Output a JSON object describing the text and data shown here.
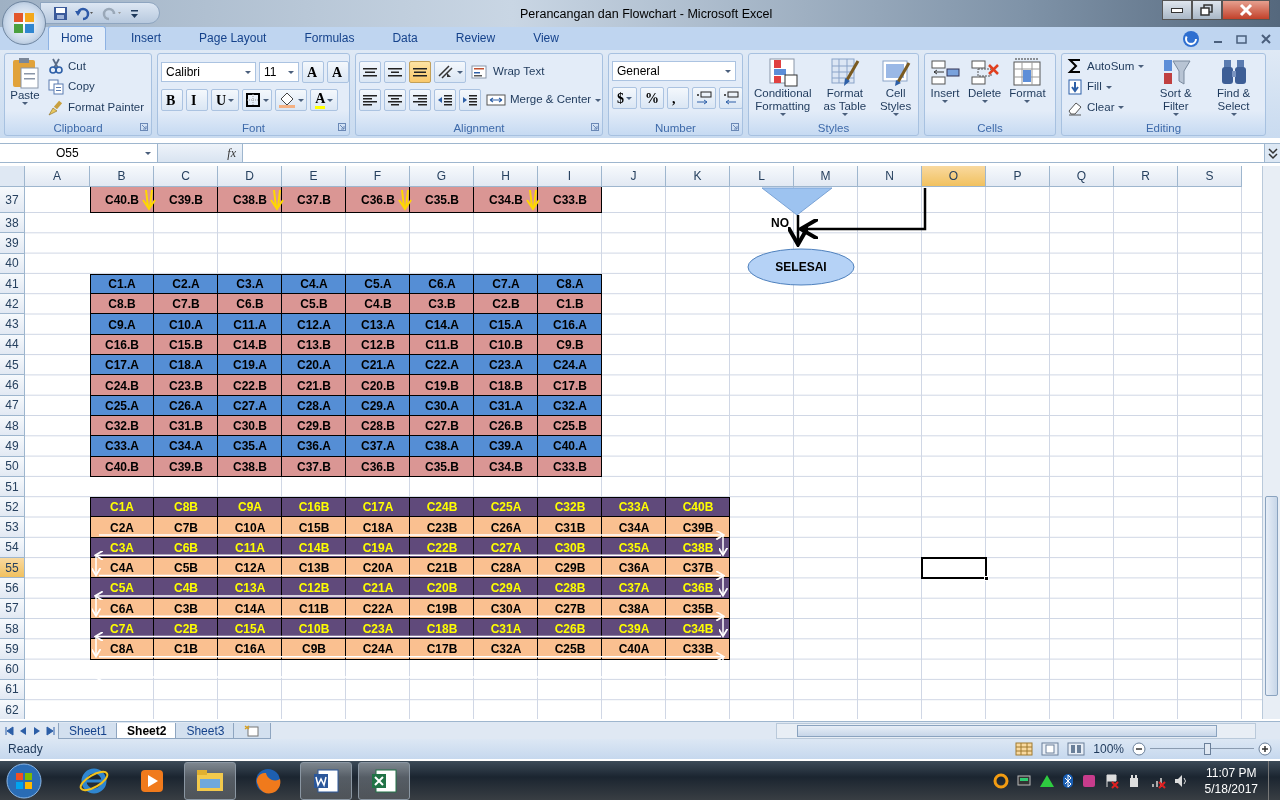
{
  "window": {
    "title": "Perancangan dan Flowchart - Microsoft Excel"
  },
  "tabs": [
    {
      "label": "Home",
      "selected": true
    },
    {
      "label": "Insert",
      "selected": false
    },
    {
      "label": "Page Layout",
      "selected": false
    },
    {
      "label": "Formulas",
      "selected": false
    },
    {
      "label": "Data",
      "selected": false
    },
    {
      "label": "Review",
      "selected": false
    },
    {
      "label": "View",
      "selected": false
    }
  ],
  "ribbon": [
    {
      "label": "Clipboard",
      "launcher": true,
      "parts": [
        [
          {
            "kind": "big",
            "label": "Paste",
            "caret": true
          }
        ],
        [
          {
            "kind": "small",
            "label": "Cut",
            "caret": false
          },
          {
            "kind": "small",
            "label": "Copy",
            "caret": false
          },
          {
            "kind": "small",
            "label": "Format Painter",
            "caret": false
          }
        ]
      ]
    },
    {
      "label": "Font",
      "launcher": true,
      "parts": [
        [
          {
            "kind": "field",
            "value": "Calibri"
          },
          {
            "kind": "field",
            "value": "11"
          },
          {
            "kind": "glyph",
            "text": "A",
            "caret": false
          },
          {
            "kind": "glyph",
            "text": "A",
            "caret": false
          }
        ],
        [
          {
            "kind": "glyph",
            "text": "B",
            "caret": false
          },
          {
            "kind": "glyph",
            "text": "I",
            "caret": false
          },
          {
            "kind": "glyph",
            "text": "U",
            "caret": true
          },
          {
            "kind": "icon",
            "caret": true
          },
          {
            "kind": "icon",
            "caret": true
          },
          {
            "kind": "glyph",
            "text": "A",
            "caret": true
          }
        ]
      ]
    },
    {
      "label": "Alignment",
      "launcher": true,
      "parts": [
        [
          {
            "kind": "icon",
            "caret": false,
            "selected": false
          },
          {
            "kind": "icon",
            "caret": false,
            "selected": false
          },
          {
            "kind": "icon",
            "caret": false,
            "selected": true
          },
          {
            "kind": "icon",
            "caret": true
          },
          {
            "kind": "small",
            "label": "Wrap Text",
            "caret": false
          }
        ],
        [
          {
            "kind": "icon",
            "caret": false
          },
          {
            "kind": "icon",
            "caret": false
          },
          {
            "kind": "icon",
            "caret": false
          },
          {
            "kind": "icon",
            "caret": false
          },
          {
            "kind": "icon",
            "caret": false
          },
          {
            "kind": "small",
            "label": "Merge & Center",
            "caret": true
          }
        ]
      ]
    },
    {
      "label": "Number",
      "launcher": true,
      "parts": [
        [
          {
            "kind": "field",
            "value": "General"
          }
        ],
        [
          {
            "kind": "glyph",
            "text": "$",
            "caret": true
          },
          {
            "kind": "glyph",
            "text": "%",
            "caret": false
          },
          {
            "kind": "glyph",
            "text": ",",
            "caret": false
          },
          {
            "kind": "icon",
            "caret": false
          },
          {
            "kind": "icon",
            "caret": false
          }
        ]
      ]
    },
    {
      "label": "Styles",
      "launcher": false,
      "parts": [
        [
          {
            "kind": "big",
            "label": "Conditional Formatting",
            "caret": true
          }
        ],
        [
          {
            "kind": "big",
            "label": "Format as Table",
            "caret": true
          }
        ],
        [
          {
            "kind": "big",
            "label": "Cell Styles",
            "caret": true
          }
        ]
      ]
    },
    {
      "label": "Cells",
      "launcher": false,
      "parts": [
        [
          {
            "kind": "big",
            "label": "Insert",
            "caret": true
          }
        ],
        [
          {
            "kind": "big",
            "label": "Delete",
            "caret": true
          }
        ],
        [
          {
            "kind": "big",
            "label": "Format",
            "caret": true
          }
        ]
      ]
    },
    {
      "label": "Editing",
      "launcher": false,
      "parts": [
        [
          {
            "kind": "small",
            "label": "AutoSum",
            "caret": true
          },
          {
            "kind": "small",
            "label": "Fill",
            "caret": true
          },
          {
            "kind": "small",
            "label": "Clear",
            "caret": true
          }
        ],
        [
          {
            "kind": "big",
            "label": "Sort & Filter",
            "caret": true
          }
        ],
        [
          {
            "kind": "big",
            "label": "Find & Select",
            "caret": true
          }
        ]
      ]
    }
  ],
  "formula_bar": {
    "name_box": "O55",
    "fx": "fx"
  },
  "columns": [
    {
      "label": "A",
      "selected": false
    },
    {
      "label": "B",
      "selected": false
    },
    {
      "label": "C",
      "selected": false
    },
    {
      "label": "D",
      "selected": false
    },
    {
      "label": "E",
      "selected": false
    },
    {
      "label": "F",
      "selected": false
    },
    {
      "label": "G",
      "selected": false
    },
    {
      "label": "H",
      "selected": false
    },
    {
      "label": "I",
      "selected": false
    },
    {
      "label": "J",
      "selected": false
    },
    {
      "label": "K",
      "selected": false
    },
    {
      "label": "L",
      "selected": false
    },
    {
      "label": "M",
      "selected": false
    },
    {
      "label": "N",
      "selected": false
    },
    {
      "label": "O",
      "selected": true
    },
    {
      "label": "P",
      "selected": false
    },
    {
      "label": "Q",
      "selected": false
    },
    {
      "label": "R",
      "selected": false
    },
    {
      "label": "S",
      "selected": false
    }
  ],
  "rows": [
    {
      "number": "37",
      "selected": false,
      "kind": "pink",
      "cells": [
        "C40.B",
        "C39.B",
        "C38.B",
        "C37.B",
        "C36.B",
        "C35.B",
        "C34.B",
        "C33.B"
      ]
    },
    {
      "number": "38",
      "selected": false
    },
    {
      "number": "39",
      "selected": false
    },
    {
      "number": "40",
      "selected": false
    },
    {
      "number": "41",
      "selected": false,
      "kind": "blue",
      "cells": [
        "C1.A",
        "C2.A",
        "C3.A",
        "C4.A",
        "C5.A",
        "C6.A",
        "C7.A",
        "C8.A"
      ]
    },
    {
      "number": "42",
      "selected": false,
      "kind": "pink",
      "cells": [
        "C8.B",
        "C7.B",
        "C6.B",
        "C5.B",
        "C4.B",
        "C3.B",
        "C2.B",
        "C1.B"
      ]
    },
    {
      "number": "43",
      "selected": false,
      "kind": "blue",
      "cells": [
        "C9.A",
        "C10.A",
        "C11.A",
        "C12.A",
        "C13.A",
        "C14.A",
        "C15.A",
        "C16.A"
      ]
    },
    {
      "number": "44",
      "selected": false,
      "kind": "pink",
      "cells": [
        "C16.B",
        "C15.B",
        "C14.B",
        "C13.B",
        "C12.B",
        "C11.B",
        "C10.B",
        "C9.B"
      ]
    },
    {
      "number": "45",
      "selected": false,
      "kind": "blue",
      "cells": [
        "C17.A",
        "C18.A",
        "C19.A",
        "C20.A",
        "C21.A",
        "C22.A",
        "C23.A",
        "C24.A"
      ]
    },
    {
      "number": "46",
      "selected": false,
      "kind": "pink",
      "cells": [
        "C24.B",
        "C23.B",
        "C22.B",
        "C21.B",
        "C20.B",
        "C19.B",
        "C18.B",
        "C17.B"
      ]
    },
    {
      "number": "47",
      "selected": false,
      "kind": "blue",
      "cells": [
        "C25.A",
        "C26.A",
        "C27.A",
        "C28.A",
        "C29.A",
        "C30.A",
        "C31.A",
        "C32.A"
      ]
    },
    {
      "number": "48",
      "selected": false,
      "kind": "pink",
      "cells": [
        "C32.B",
        "C31.B",
        "C30.B",
        "C29.B",
        "C28.B",
        "C27.B",
        "C26.B",
        "C25.B"
      ]
    },
    {
      "number": "49",
      "selected": false,
      "kind": "blue",
      "cells": [
        "C33.A",
        "C34.A",
        "C35.A",
        "C36.A",
        "C37.A",
        "C38.A",
        "C39.A",
        "C40.A"
      ]
    },
    {
      "number": "50",
      "selected": false,
      "kind": "pink",
      "cells": [
        "C40.B",
        "C39.B",
        "C38.B",
        "C37.B",
        "C36.B",
        "C35.B",
        "C34.B",
        "C33.B"
      ]
    },
    {
      "number": "51",
      "selected": false
    },
    {
      "number": "52",
      "selected": false,
      "kind": "purple",
      "cells": [
        "C1A",
        "C8B",
        "C9A",
        "C16B",
        "C17A",
        "C24B",
        "C25A",
        "C32B",
        "C33A",
        "C40B"
      ]
    },
    {
      "number": "53",
      "selected": false,
      "kind": "peach",
      "cells": [
        "C2A",
        "C7B",
        "C10A",
        "C15B",
        "C18A",
        "C23B",
        "C26A",
        "C31B",
        "C34A",
        "C39B"
      ]
    },
    {
      "number": "54",
      "selected": false,
      "kind": "purple",
      "cells": [
        "C3A",
        "C6B",
        "C11A",
        "C14B",
        "C19A",
        "C22B",
        "C27A",
        "C30B",
        "C35A",
        "C38B"
      ]
    },
    {
      "number": "55",
      "selected": true,
      "kind": "peach",
      "cells": [
        "C4A",
        "C5B",
        "C12A",
        "C13B",
        "C20A",
        "C21B",
        "C28A",
        "C29B",
        "C36A",
        "C37B"
      ]
    },
    {
      "number": "56",
      "selected": false,
      "kind": "purple",
      "cells": [
        "C5A",
        "C4B",
        "C13A",
        "C12B",
        "C21A",
        "C20B",
        "C29A",
        "C28B",
        "C37A",
        "C36B"
      ]
    },
    {
      "number": "57",
      "selected": false,
      "kind": "peach",
      "cells": [
        "C6A",
        "C3B",
        "C14A",
        "C11B",
        "C22A",
        "C19B",
        "C30A",
        "C27B",
        "C38A",
        "C35B"
      ]
    },
    {
      "number": "58",
      "selected": false,
      "kind": "purple",
      "cells": [
        "C7A",
        "C2B",
        "C15A",
        "C10B",
        "C23A",
        "C18B",
        "C31A",
        "C26B",
        "C39A",
        "C34B"
      ]
    },
    {
      "number": "59",
      "selected": false,
      "kind": "peach",
      "cells": [
        "C8A",
        "C1B",
        "C16A",
        "C9B",
        "C24A",
        "C17B",
        "C32A",
        "C25B",
        "C40A",
        "C33B"
      ]
    },
    {
      "number": "60",
      "selected": false
    },
    {
      "number": "61",
      "selected": false
    },
    {
      "number": "62",
      "selected": false
    }
  ],
  "flowchart": {
    "branch_label": "NO",
    "end_label": "SELESAI"
  },
  "sheet_tabs": [
    {
      "label": "Sheet1",
      "selected": false
    },
    {
      "label": "Sheet2",
      "selected": true
    },
    {
      "label": "Sheet3",
      "selected": false
    }
  ],
  "status_bar": {
    "status": "Ready",
    "zoom": "100%",
    "zoom_slider": {
      "level": 0.55
    }
  },
  "taskbar": {
    "apps": [
      {
        "running": false
      },
      {
        "running": false
      },
      {
        "running": true
      },
      {
        "running": false
      },
      {
        "running": true
      },
      {
        "running": true
      }
    ],
    "time": "11:07 PM",
    "date": "5/18/2017"
  }
}
